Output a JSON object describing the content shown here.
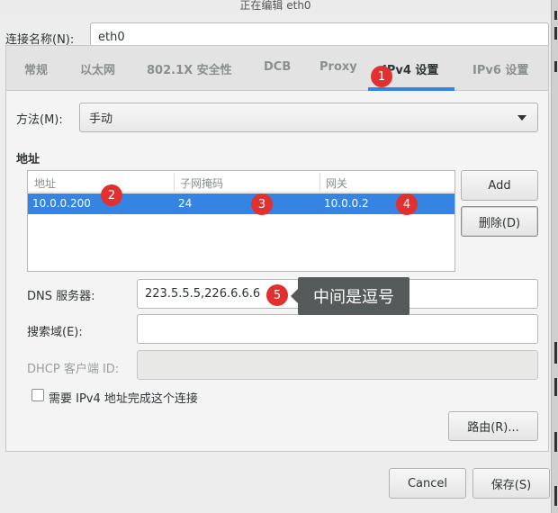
{
  "window": {
    "title": "正在编辑 eth0"
  },
  "connection_name": {
    "label": "连接名称(N):",
    "value": "eth0"
  },
  "tabs": [
    {
      "label": "常规"
    },
    {
      "label": "以太网"
    },
    {
      "label": "802.1X 安全性"
    },
    {
      "label": "DCB"
    },
    {
      "label": "Proxy"
    },
    {
      "label": "IPv4 设置"
    },
    {
      "label": "IPv6 设置"
    }
  ],
  "method": {
    "label": "方法(M):",
    "value": "手动"
  },
  "addresses": {
    "section_title": "地址",
    "columns": [
      "地址",
      "子网掩码",
      "网关"
    ],
    "rows": [
      {
        "address": "10.0.0.200",
        "netmask": "24",
        "gateway": "10.0.0.2"
      }
    ],
    "add_label": "Add",
    "delete_label": "删除(D)"
  },
  "dns": {
    "label": "DNS 服务器:",
    "value": "223.5.5.5,226.6.6.6"
  },
  "search_domains": {
    "label": "搜索域(E):",
    "value": ""
  },
  "dhcp_client_id": {
    "label": "DHCP 客户端 ID:",
    "value": ""
  },
  "require_ipv4": {
    "label": "需要 IPv4 地址完成这个连接",
    "checked": false
  },
  "routes_label": "路由(R)...",
  "footer": {
    "cancel_label": "Cancel",
    "save_label": "保存(S)"
  },
  "annotations": {
    "badges": [
      "1",
      "2",
      "3",
      "4",
      "5"
    ],
    "tooltip": "中间是逗号",
    "badge_color": "#e03131"
  },
  "colors": {
    "accent": "#3584e4"
  }
}
